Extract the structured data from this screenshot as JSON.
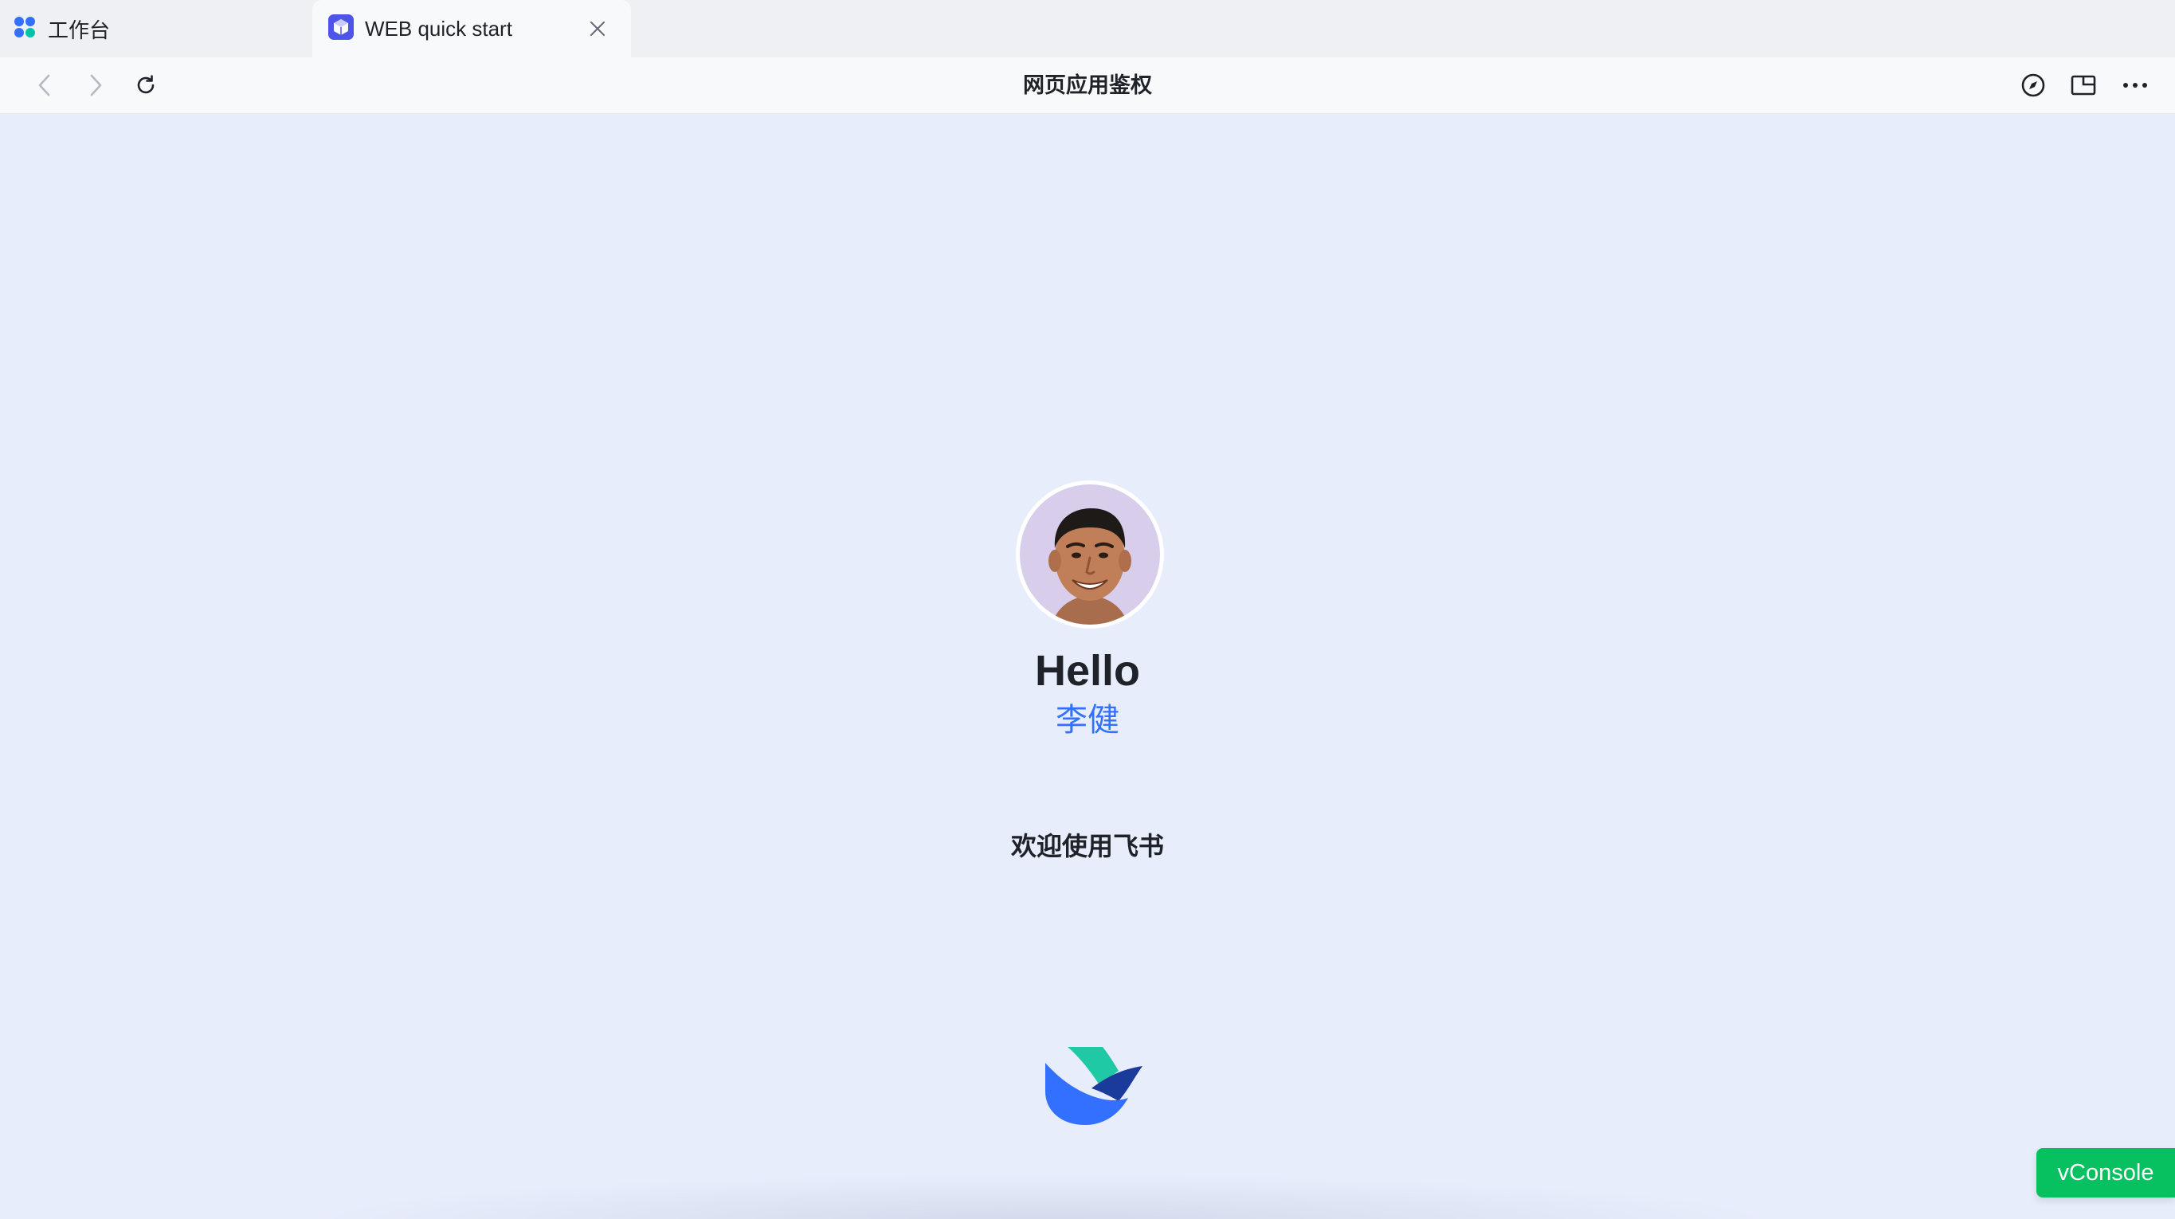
{
  "tabs": [
    {
      "label": "工作台",
      "icon": "apps-grid-icon"
    },
    {
      "label": "WEB quick start",
      "icon": "app-cube-icon",
      "active": true
    }
  ],
  "navbar": {
    "title": "网页应用鉴权",
    "icons": [
      "back-arrow-icon",
      "forward-arrow-icon",
      "refresh-icon",
      "compass-icon",
      "window-split-icon",
      "more-icon"
    ]
  },
  "main": {
    "greeting": "Hello",
    "user_name": "李健",
    "welcome_text": "欢迎使用飞书",
    "logo": "feishu-logo"
  },
  "vconsole": {
    "label": "vConsole",
    "color": "#07c160"
  },
  "colors": {
    "background": "#e8edfc",
    "accent": "#3370ff"
  }
}
